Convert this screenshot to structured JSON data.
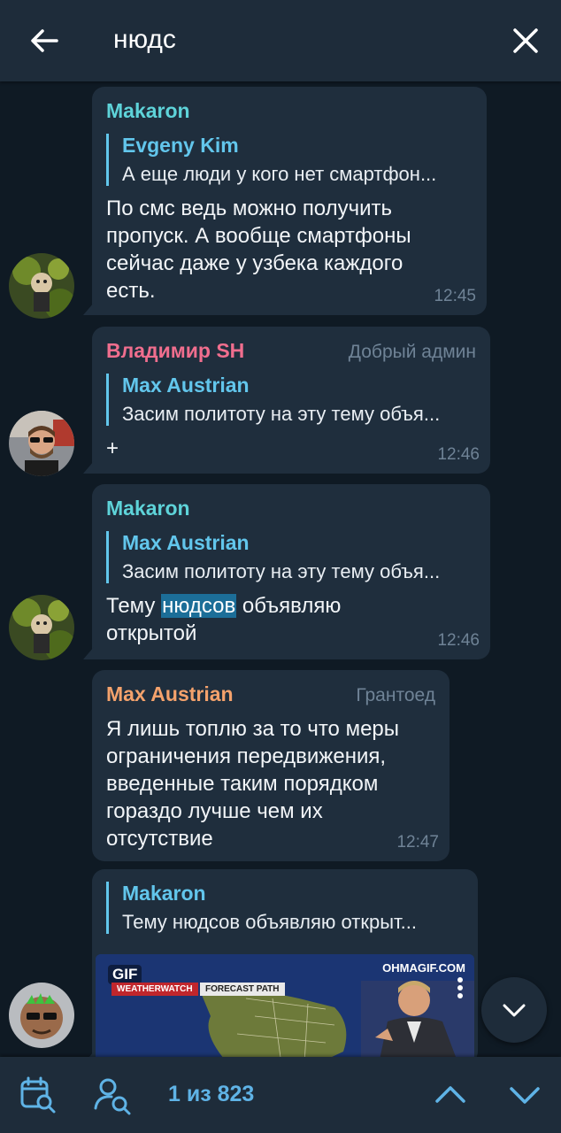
{
  "search": {
    "query": "нюдс"
  },
  "messages": [
    {
      "sender": "Makaron",
      "sender_color": "#5ed3d9",
      "role": "",
      "reply_name": "Evgeny Kim",
      "reply_text": "А еще люди у кого нет смартфон...",
      "text": "По смс ведь можно получить пропуск. А вообще смартфоны сейчас даже у узбека каждого есть.",
      "time": "12:45"
    },
    {
      "sender": "Владимир SH",
      "sender_color": "#f06e8e",
      "role": "Добрый админ",
      "reply_name": "Max Austrian",
      "reply_text": "Засим политоту на эту тему объя...",
      "text": "+",
      "time": "12:46"
    },
    {
      "sender": "Makaron",
      "sender_color": "#5ed3d9",
      "role": "",
      "reply_name": "Max Austrian",
      "reply_text": "Засим политоту на эту тему объя...",
      "text_before": "Тему ",
      "text_highlight": "нюдсов",
      "text_after": " объявляю открытой",
      "time": "12:46"
    },
    {
      "sender": "Max Austrian",
      "sender_color": "#f4a26c",
      "role": "Грантоед",
      "text": "Я лишь топлю за то что меры ограничения передвижения, введенные таким порядком гораздо лучше чем их отсутствие",
      "time": "12:47"
    },
    {
      "reply_name": "Makaron",
      "reply_text": "Тему нюдсов объявляю открыт...",
      "gif": {
        "label": "GIF",
        "watermark": "OHMAGIF.COM",
        "bar1": "WEATHERWATCH",
        "bar2": "FORECAST PATH"
      }
    }
  ],
  "footer": {
    "counter": "1 из 823"
  },
  "colors": {
    "accent": "#5fb3e6",
    "bubble": "#1f2e3d",
    "background": "#0f1a24",
    "bar": "#1e2c3a",
    "highlight": "#1c6e98"
  },
  "icons": [
    "back-arrow-icon",
    "close-icon",
    "calendar-search-icon",
    "user-search-icon",
    "chevron-up-icon",
    "chevron-down-icon"
  ]
}
